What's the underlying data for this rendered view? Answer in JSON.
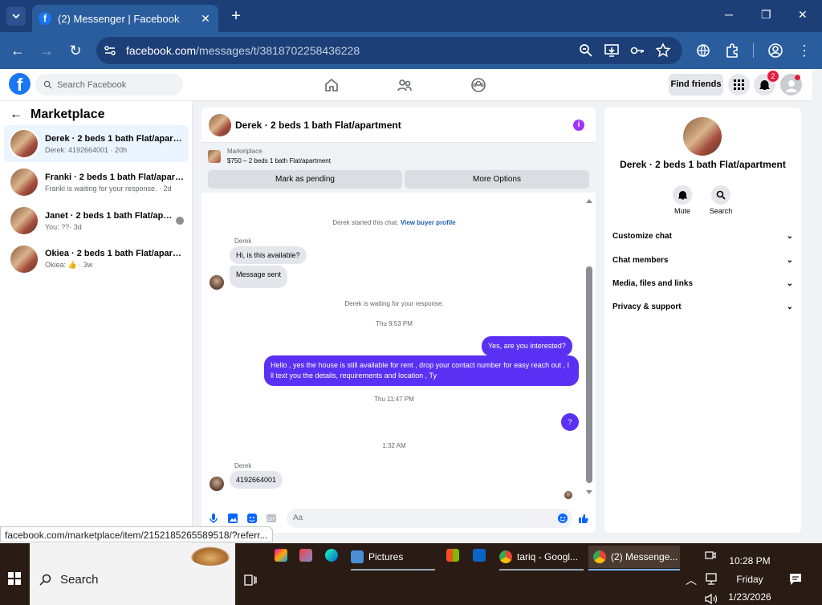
{
  "browser": {
    "tab_title": "(2) Messenger | Facebook",
    "url_host": "facebook.com",
    "url_path": "/messages/t/3818702258436228",
    "status_url": "facebook.com/marketplace/item/2152185265589518/?referr..."
  },
  "fb_header": {
    "search_placeholder": "Search Facebook",
    "find_friends": "Find friends",
    "notification_count": "2"
  },
  "left": {
    "title": "Marketplace",
    "conversations": [
      {
        "name": "Derek · 2 beds 1 bath Flat/apartme...",
        "preview": "Derek: 4192664001 · 20h"
      },
      {
        "name": "Franki · 2 beds 1 bath Flat/apartme...",
        "preview": "Franki is waiting for your response. · 2d"
      },
      {
        "name": "Janet · 2 beds 1 bath Flat/apart...",
        "preview": "You: ??· 3d"
      },
      {
        "name": "Okiea · 2 beds 1 bath Flat/apartment",
        "preview": "Okiea: 👍 · 3w"
      }
    ]
  },
  "chat": {
    "title": "Derek · 2 beds 1 bath Flat/apartment",
    "marketplace_label": "Marketplace",
    "listing": "$750 – 2 beds 1 bath Flat/apartment",
    "mark_pending": "Mark as pending",
    "more_options": "More Options",
    "started": "Derek started this chat.",
    "view_buyer": "View buyer profile",
    "sender": "Derek",
    "msg1": "Hi, is this available?",
    "msg2": "Message sent",
    "waiting": "Derek is waiting for your response.",
    "time1": "Thu 9:53 PM",
    "out1": "Yes, are you interested?",
    "out2": "Hello , yes the house is still available for rent , drop your contact number for easy reach out , I ll text you the details, requirements and location , Ty",
    "time2": "Thu 11:47 PM",
    "out3": "?",
    "time3": "1:32 AM",
    "msg3": "4192664001",
    "input_placeholder": "Aa"
  },
  "right": {
    "name": "Derek · 2 beds 1 bath Flat/apartment",
    "mute": "Mute",
    "search": "Search",
    "items": [
      "Customize chat",
      "Chat members",
      "Media, files and links",
      "Privacy & support"
    ]
  },
  "taskbar": {
    "search": "Search",
    "apps": [
      "Pictures",
      "tariq - Googl...",
      "(2) Messenge..."
    ],
    "time": "10:28 PM",
    "day": "Friday",
    "date": "1/23/2026"
  },
  "colors": {
    "brand": "#1877f2",
    "outgoing": "#5a31f4",
    "chrome": "#2a5d9e"
  }
}
